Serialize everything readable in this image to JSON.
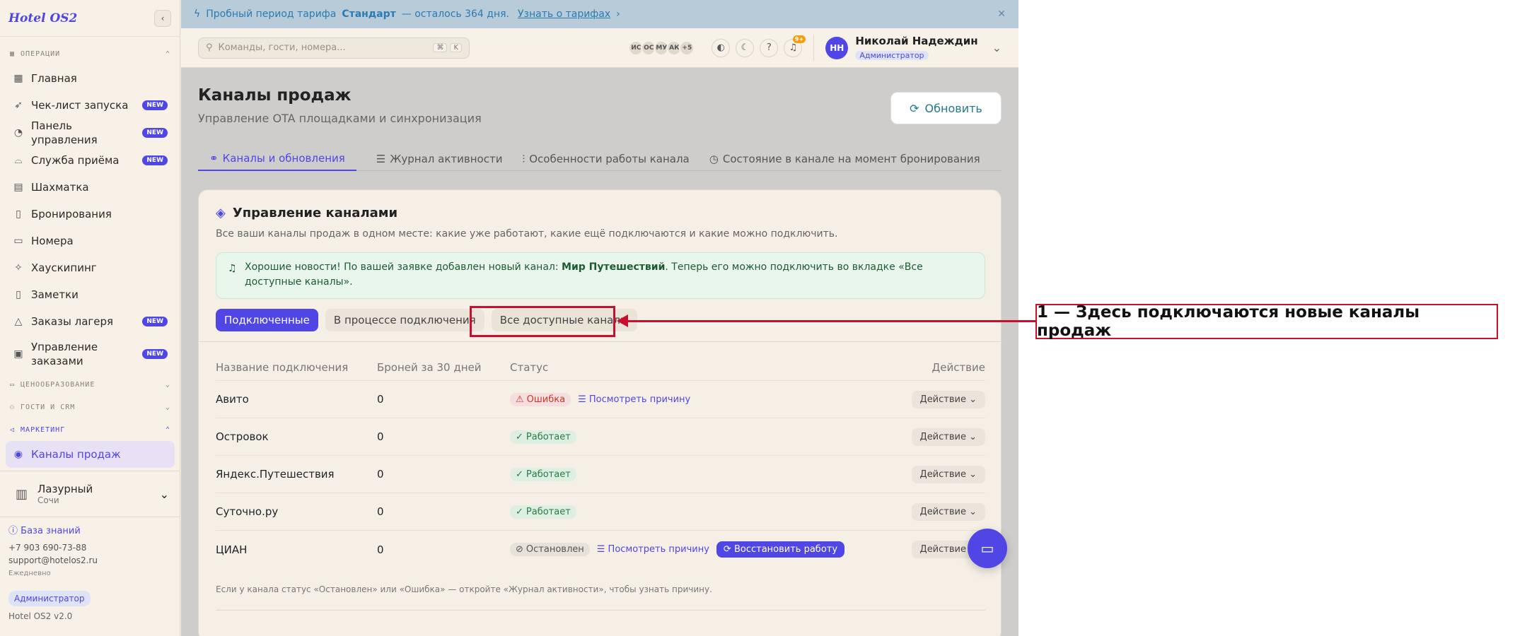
{
  "app": {
    "logo": "Hotel OS2"
  },
  "sidebar": {
    "sections": [
      {
        "label": "ОПЕРАЦИИ"
      },
      {
        "label": "ЦЕНООБРАЗОВАНИЕ"
      },
      {
        "label": "ГОСТИ И CRM"
      },
      {
        "label": "МАРКЕТИНГ"
      }
    ],
    "items": [
      {
        "label": "Главная",
        "badge": ""
      },
      {
        "label": "Чек-лист запуска",
        "badge": "NEW"
      },
      {
        "label": "Панель управления",
        "badge": "NEW"
      },
      {
        "label": "Служба приёма",
        "badge": "NEW"
      },
      {
        "label": "Шахматка",
        "badge": ""
      },
      {
        "label": "Бронирования",
        "badge": ""
      },
      {
        "label": "Номера",
        "badge": ""
      },
      {
        "label": "Хаускипинг",
        "badge": ""
      },
      {
        "label": "Заметки",
        "badge": ""
      },
      {
        "label": "Заказы лагеря",
        "badge": "NEW"
      },
      {
        "label": "Управление заказами",
        "badge": "NEW"
      }
    ],
    "marketing_items": [
      {
        "label": "Каналы продаж"
      }
    ],
    "property": {
      "name": "Лазурный",
      "city": "Сочи"
    },
    "footer": {
      "kb": "База знаний",
      "phone": "+7 903 690-73-88",
      "email": "support@hotelos2.ru",
      "hours": "Ежедневно",
      "role": "Администратор",
      "version": "Hotel OS2 v2.0"
    }
  },
  "banner": {
    "pre": "Пробный период тарифа",
    "plan": "Стандарт",
    "post": "— осталось 364 дня.",
    "link": "Узнать о тарифах"
  },
  "topbar": {
    "search_placeholder": "Команды, гости, номера...",
    "kbd": [
      "⌘",
      "K"
    ],
    "avatars": [
      "ИС",
      "ОС",
      "МУ",
      "АК",
      "+5"
    ],
    "notif_count": "9+",
    "user_initials": "НН",
    "user_name": "Николай Надеждин",
    "user_role": "Администратор"
  },
  "page": {
    "title": "Каналы продаж",
    "subtitle": "Управление OTA площадками и синхронизация",
    "refresh": "Обновить"
  },
  "tabs": [
    {
      "label": "Каналы и обновления"
    },
    {
      "label": "Журнал активности"
    },
    {
      "label": "Особенности работы канала"
    },
    {
      "label": "Состояние в канале на момент бронирования"
    }
  ],
  "card": {
    "title": "Управление каналами",
    "subtitle": "Все ваши каналы продаж в одном месте: какие уже работают, какие ещё подключаются и какие можно подключить.",
    "alert": {
      "pre": "Хорошие новости! По вашей заявке добавлен новый канал:",
      "channel": "Мир Путешествий",
      "post": ". Теперь его можно подключить во вкладке «Все доступные каналы»."
    },
    "pills": [
      "Подключенные",
      "В процессе подключения",
      "Все доступные каналы"
    ],
    "columns": [
      "Название подключения",
      "Броней за 30 дней",
      "Статус",
      "Действие"
    ],
    "rows": [
      {
        "name": "Авито",
        "bookings": "0",
        "status": "Ошибка",
        "kind": "err",
        "why": "Посмотреть причину",
        "restore": "",
        "action": "Действие"
      },
      {
        "name": "Островок",
        "bookings": "0",
        "status": "Работает",
        "kind": "ok",
        "why": "",
        "restore": "",
        "action": "Действие"
      },
      {
        "name": "Яндекс.Путешествия",
        "bookings": "0",
        "status": "Работает",
        "kind": "ok",
        "why": "",
        "restore": "",
        "action": "Действие"
      },
      {
        "name": "Суточно.ру",
        "bookings": "0",
        "status": "Работает",
        "kind": "ok",
        "why": "",
        "restore": "",
        "action": "Действие"
      },
      {
        "name": "ЦИАН",
        "bookings": "0",
        "status": "Остановлен",
        "kind": "off",
        "why": "Посмотреть причину",
        "restore": "Восстановить работу",
        "action": "Действие"
      }
    ],
    "note": "Если у канала статус «Остановлен» или «Ошибка» — откройте «Журнал активности», чтобы узнать причину."
  },
  "annotation": {
    "label": "1 — Здесь подключаются новые каналы продаж"
  }
}
